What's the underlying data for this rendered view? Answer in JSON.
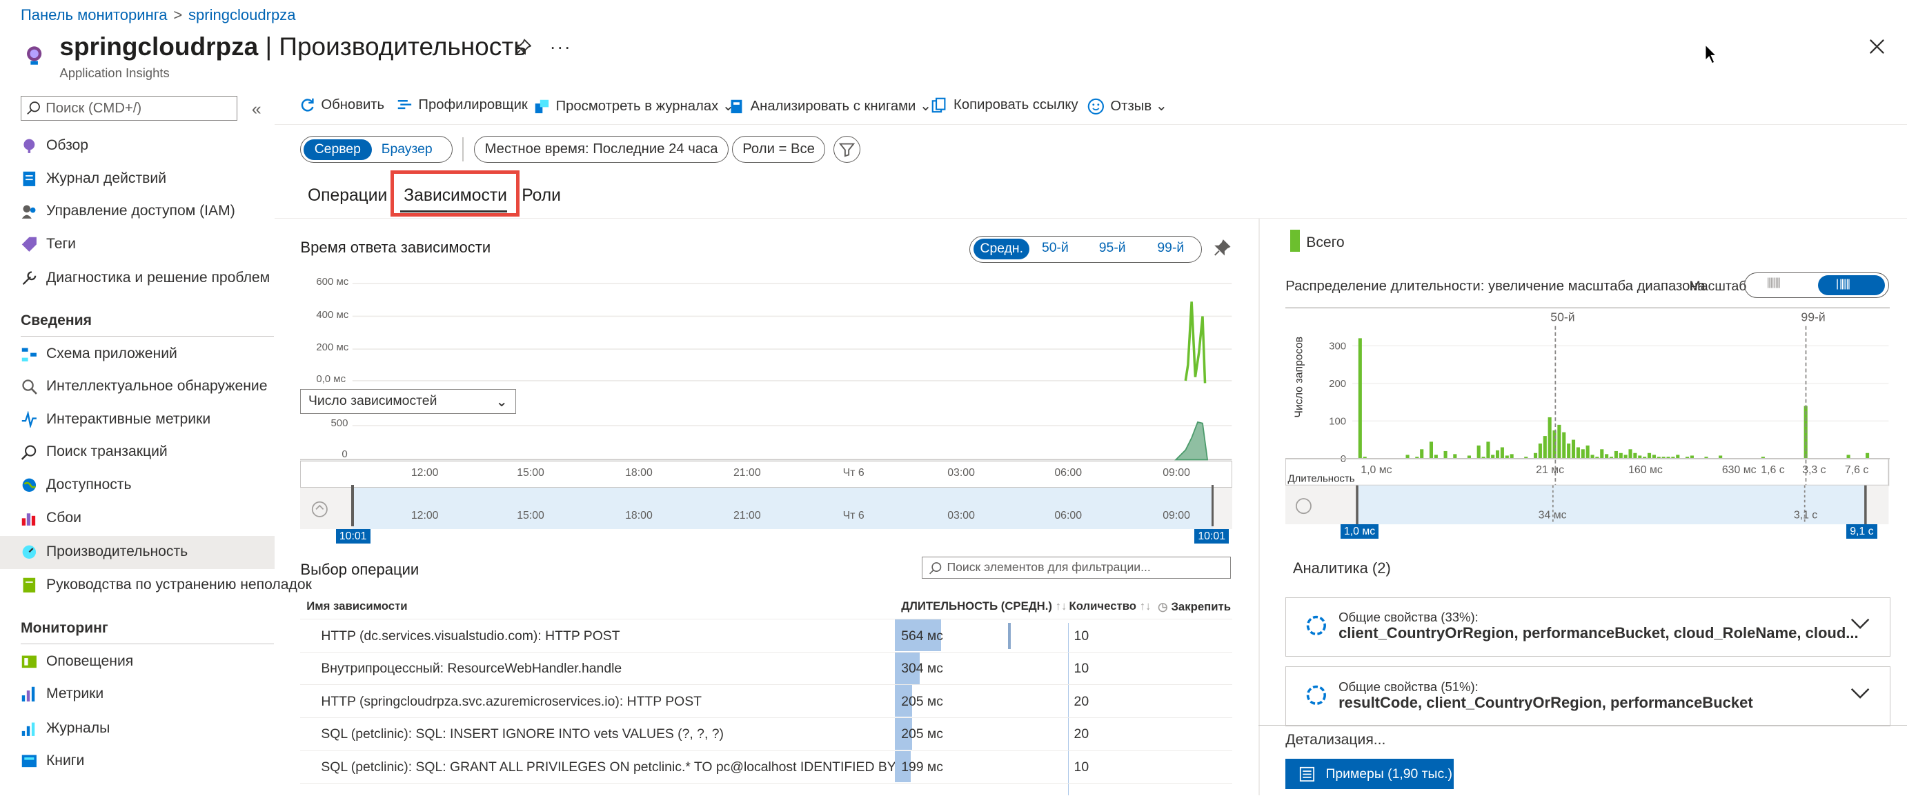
{
  "breadcrumb": {
    "home": "Панель мониторинга",
    "current": "springcloudrpza"
  },
  "header": {
    "title_resource": "springcloudrpza",
    "title_page": "Производительность",
    "subtitle": "Application Insights"
  },
  "sidebar": {
    "search_placeholder": "Поиск (CMD+/)",
    "items": [
      {
        "label": "Обзор"
      },
      {
        "label": "Журнал действий"
      },
      {
        "label": "Управление доступом (IAM)"
      },
      {
        "label": "Теги"
      },
      {
        "label": "Диагностика и решение проблем"
      }
    ],
    "section_insights": "Сведения",
    "insights_items": [
      {
        "label": "Схема приложений"
      },
      {
        "label": "Интеллектуальное обнаружение"
      },
      {
        "label": "Интерактивные метрики"
      },
      {
        "label": "Поиск транзакций"
      },
      {
        "label": "Доступность"
      },
      {
        "label": "Сбои"
      },
      {
        "label": "Производительность"
      },
      {
        "label": "Руководства по устранению неполадок"
      }
    ],
    "section_monitoring": "Мониторинг",
    "monitoring_items": [
      {
        "label": "Оповещения"
      },
      {
        "label": "Метрики"
      },
      {
        "label": "Журналы"
      },
      {
        "label": "Книги"
      }
    ]
  },
  "toolbar": {
    "refresh": "Обновить",
    "profiler": "Профилировщик",
    "view_logs": "Просмотреть в журналах",
    "analyze_workbooks": "Анализировать с книгами",
    "copy_link": "Копировать ссылку",
    "feedback": "Отзыв"
  },
  "filters": {
    "server": "Сервер",
    "browser": "Браузер",
    "time": "Местное время: Последние 24 часа",
    "roles": "Роли = Все"
  },
  "tabs": {
    "operations": "Операции",
    "dependencies": "Зависимости",
    "roles": "Роли"
  },
  "response_chart": {
    "title": "Время ответа зависимости",
    "pct_avg": "Средн.",
    "pct_50": "50-й",
    "pct_95": "95-й",
    "pct_99": "99-й",
    "y_ticks": [
      "600 мс",
      "400 мс",
      "200 мс",
      "0,0 мс"
    ],
    "count_dropdown": "Число зависимостей",
    "count_ticks": [
      "500",
      "0"
    ],
    "x_ticks": [
      "12:00",
      "15:00",
      "18:00",
      "21:00",
      "Чт 6",
      "03:00",
      "06:00",
      "09:00"
    ],
    "range_start": "10:01",
    "range_end": "10:01"
  },
  "chart_data": {
    "type": "bar",
    "title": "Распределение длительности: увеличение масштаба диапазона",
    "xlabel": "Длительность",
    "ylabel": "Число запросов",
    "y_ticks": [
      "300",
      "200",
      "100",
      "0"
    ],
    "x_ticks": [
      "1,0 мс",
      "21 мс",
      "160 мс",
      "630 мс",
      "1,6 с",
      "3,3 с",
      "7,6 с"
    ],
    "markers": [
      "50-й",
      "99-й"
    ],
    "ylim": [
      0,
      320
    ],
    "series": [
      {
        "name": "Всего",
        "color": "#6cbf2e",
        "values": [
          320,
          5,
          0,
          0,
          0,
          0,
          0,
          0,
          0,
          0,
          10,
          0,
          5,
          25,
          0,
          45,
          10,
          0,
          20,
          0,
          12,
          0,
          0,
          8,
          0,
          35,
          5,
          45,
          10,
          22,
          30,
          8,
          12,
          0,
          0,
          5,
          0,
          15,
          40,
          60,
          110,
          75,
          90,
          70,
          40,
          50,
          30,
          25,
          35,
          10,
          5,
          25,
          12,
          5,
          20,
          15,
          10,
          25,
          15,
          8,
          5,
          15,
          10,
          5,
          5,
          5,
          5,
          10,
          0,
          5,
          8,
          0,
          0,
          5,
          0,
          0,
          8,
          0,
          0,
          0,
          0,
          0,
          0,
          0,
          0,
          5,
          0,
          0,
          0,
          0,
          0,
          0,
          0,
          0,
          140,
          0,
          0,
          0,
          0,
          0,
          0,
          0,
          0,
          10,
          0,
          0,
          0,
          15
        ]
      }
    ],
    "range_start": "1,0 мс",
    "range_end": "9,1 с",
    "brush_ticks": [
      "34 мс",
      "3,1 с"
    ]
  },
  "scale": {
    "label": "Масштаб"
  },
  "op_table": {
    "title": "Выбор операции",
    "search_placeholder": "Поиск элементов для фильтрации...",
    "headers": {
      "name": "Имя зависимости",
      "duration": "ДЛИТЕЛЬНОСТЬ (СРЕДН.)",
      "count": "Количество",
      "pin": "Закрепить"
    },
    "rows": [
      {
        "name": "HTTP (dc.services.visualstudio.com): HTTP POST",
        "duration": "564 мс",
        "duration_ms": 564,
        "count": "10"
      },
      {
        "name": "Внутрипроцессный: ResourceWebHandler.handle",
        "duration": "304 мс",
        "duration_ms": 304,
        "count": "10"
      },
      {
        "name": "HTTP (springcloudrpza.svc.azuremicroservices.io): HTTP POST",
        "duration": "205 мс",
        "duration_ms": 205,
        "count": "20"
      },
      {
        "name": "SQL (petclinic): SQL: INSERT IGNORE INTO vets VALUES (?, ?, ?)",
        "duration": "205 мс",
        "duration_ms": 205,
        "count": "20"
      },
      {
        "name": "SQL (petclinic): SQL: GRANT ALL PRIVILEGES ON petclinic.* TO pc@localhost IDENTIFIED BY ?",
        "duration": "199 мс",
        "duration_ms": 199,
        "count": "10"
      }
    ]
  },
  "insights": {
    "title": "Аналитика (2)",
    "items": [
      {
        "line1": "Общие свойства (33%):",
        "line2": "client_CountryOrRegion, performanceBucket, cloud_RoleName, cloud..."
      },
      {
        "line1": "Общие свойства (51%):",
        "line2": "resultCode, client_CountryOrRegion, performanceBucket"
      }
    ]
  },
  "drill": {
    "title": "Детализация...",
    "samples_button": "Примеры (1,90 тыс.)"
  }
}
